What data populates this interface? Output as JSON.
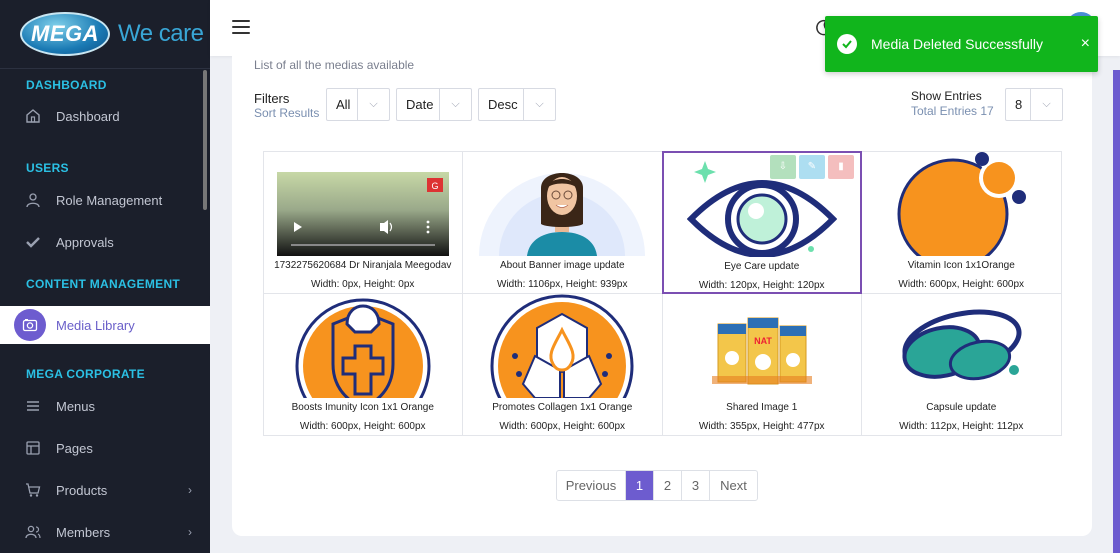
{
  "brand": {
    "logo_text": "MEGA",
    "tagline": "We care"
  },
  "sidebar": {
    "sections": [
      {
        "label": "DASHBOARD"
      },
      {
        "label": "USERS"
      },
      {
        "label": "CONTENT MANAGEMENT"
      },
      {
        "label": "MEGA CORPORATE"
      }
    ],
    "items": [
      {
        "label": "Dashboard",
        "icon": "home-icon"
      },
      {
        "label": "Role Management",
        "icon": "user-icon"
      },
      {
        "label": "Approvals",
        "icon": "check-icon"
      },
      {
        "label": "Media Library",
        "icon": "camera-icon",
        "active": true
      },
      {
        "label": "Menus",
        "icon": "menu-icon"
      },
      {
        "label": "Pages",
        "icon": "pages-icon"
      },
      {
        "label": "Products",
        "icon": "cart-icon",
        "has_submenu": true
      },
      {
        "label": "Members",
        "icon": "members-icon",
        "has_submenu": true
      }
    ]
  },
  "toast": {
    "message": "Media Deleted Successfully",
    "close": "×",
    "color": "#11b51c"
  },
  "page": {
    "subtitle": "List of all the medias available"
  },
  "filters": {
    "label": "Filters",
    "sort_label": "Sort Results",
    "type_value": "All",
    "sort_by_value": "Date",
    "order_value": "Desc"
  },
  "entries": {
    "label": "Show Entries",
    "total_label": "Total Entries 17",
    "value": "8"
  },
  "media": [
    {
      "name": "1732275620684 Dr Niranjala Meegodav",
      "dims": "Width: 0px, Height: 0px",
      "kind": "video"
    },
    {
      "name": "About Banner image update",
      "dims": "Width: 1106px, Height: 939px",
      "kind": "doctor"
    },
    {
      "name": "Eye Care update",
      "dims": "Width: 120px, Height: 120px",
      "kind": "eye",
      "selected": true
    },
    {
      "name": "Vitamin Icon 1x1Orange",
      "dims": "Width: 600px, Height: 600px",
      "kind": "vitamin"
    },
    {
      "name": "Boosts Imunity Icon 1x1 Orange",
      "dims": "Width: 600px, Height: 600px",
      "kind": "shield"
    },
    {
      "name": "Promotes Collagen 1x1 Orange",
      "dims": "Width: 600px, Height: 600px",
      "kind": "collagen"
    },
    {
      "name": "Shared Image 1",
      "dims": "Width: 355px, Height: 477px",
      "kind": "boxes"
    },
    {
      "name": "Capsule update",
      "dims": "Width: 112px, Height: 112px",
      "kind": "capsule"
    }
  ],
  "pagination": {
    "previous": "Previous",
    "pages": [
      "1",
      "2",
      "3"
    ],
    "current": "1",
    "next": "Next"
  },
  "colors": {
    "accent": "#6d5ccf",
    "sidebar": "#1b1f2b",
    "section": "#2bc0e4",
    "orange": "#f7931e",
    "navy": "#1f2d7a"
  }
}
